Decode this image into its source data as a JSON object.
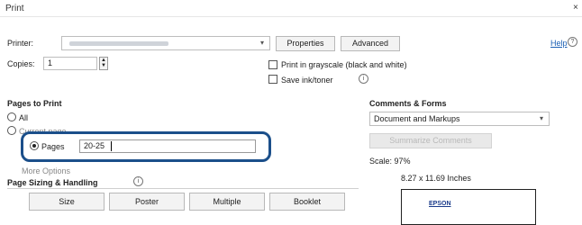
{
  "window": {
    "title": "Print",
    "close_glyph": "×"
  },
  "printer": {
    "label": "Printer:",
    "selected_value_hint": "",
    "properties_label": "Properties",
    "advanced_label": "Advanced"
  },
  "help": {
    "label": "Help",
    "icon": "help-icon"
  },
  "copies": {
    "label": "Copies:",
    "value": "1"
  },
  "options": {
    "grayscale_label": "Print in grayscale (black and white)",
    "save_ink_label": "Save ink/toner",
    "info_icon": "info-icon"
  },
  "pages_to_print": {
    "heading": "Pages to Print",
    "all_label": "All",
    "current_page_label": "Current page",
    "pages_label": "Pages",
    "pages_value": "20-25",
    "more_options_label": "More Options"
  },
  "page_sizing": {
    "heading": "Page Sizing & Handling",
    "buttons": [
      "Size",
      "Poster",
      "Multiple",
      "Booklet"
    ]
  },
  "comments_forms": {
    "heading": "Comments & Forms",
    "selected": "Document and Markups",
    "summarize_label": "Summarize Comments"
  },
  "preview": {
    "scale_label": "Scale: 97%",
    "size_label": "8.27 x 11.69 Inches",
    "brand": "EPSON"
  },
  "colors": {
    "callout_border": "#1b4f8a",
    "link_blue": "#1a5fb4"
  }
}
